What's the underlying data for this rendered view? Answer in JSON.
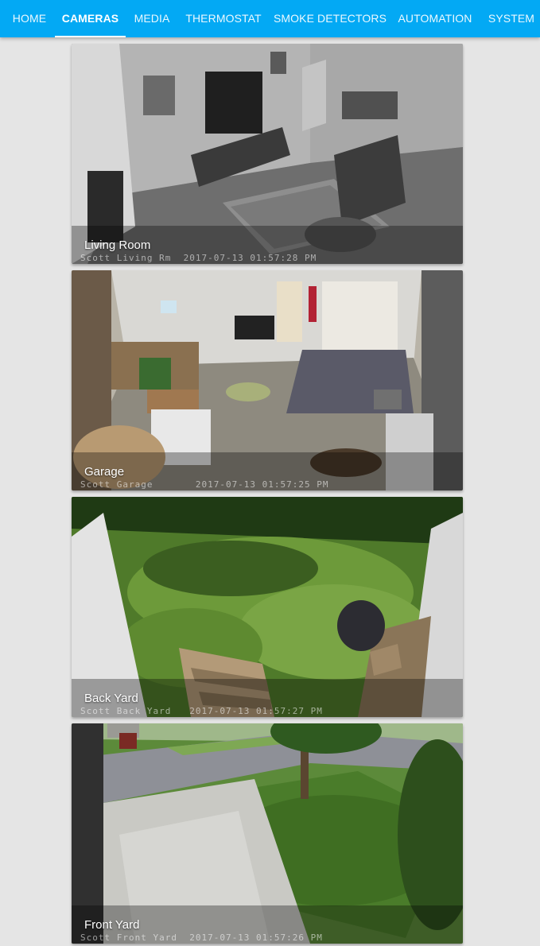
{
  "tabs": [
    {
      "label": "HOME",
      "active": false
    },
    {
      "label": "CAMERAS",
      "active": true
    },
    {
      "label": "MEDIA",
      "active": false
    },
    {
      "label": "THERMOSTAT",
      "active": false
    },
    {
      "label": "SMOKE DETECTORS",
      "active": false
    },
    {
      "label": "AUTOMATION",
      "active": false
    },
    {
      "label": "SYSTEM",
      "active": false
    }
  ],
  "colors": {
    "toolbar": "#03a9f4",
    "background": "#e5e5e5",
    "tab_text": "#ffffff"
  },
  "cameras": [
    {
      "name": "Living Room",
      "overlay": "Scott Living Rm  2017-07-13 01:57:28 PM"
    },
    {
      "name": "Garage",
      "overlay": "Scott Garage       2017-07-13 01:57:25 PM"
    },
    {
      "name": "Back Yard",
      "overlay": "Scott Back Yard   2017-07-13 01:57:27 PM"
    },
    {
      "name": "Front Yard",
      "overlay": "Scott Front Yard  2017-07-13 01:57:26 PM"
    }
  ]
}
